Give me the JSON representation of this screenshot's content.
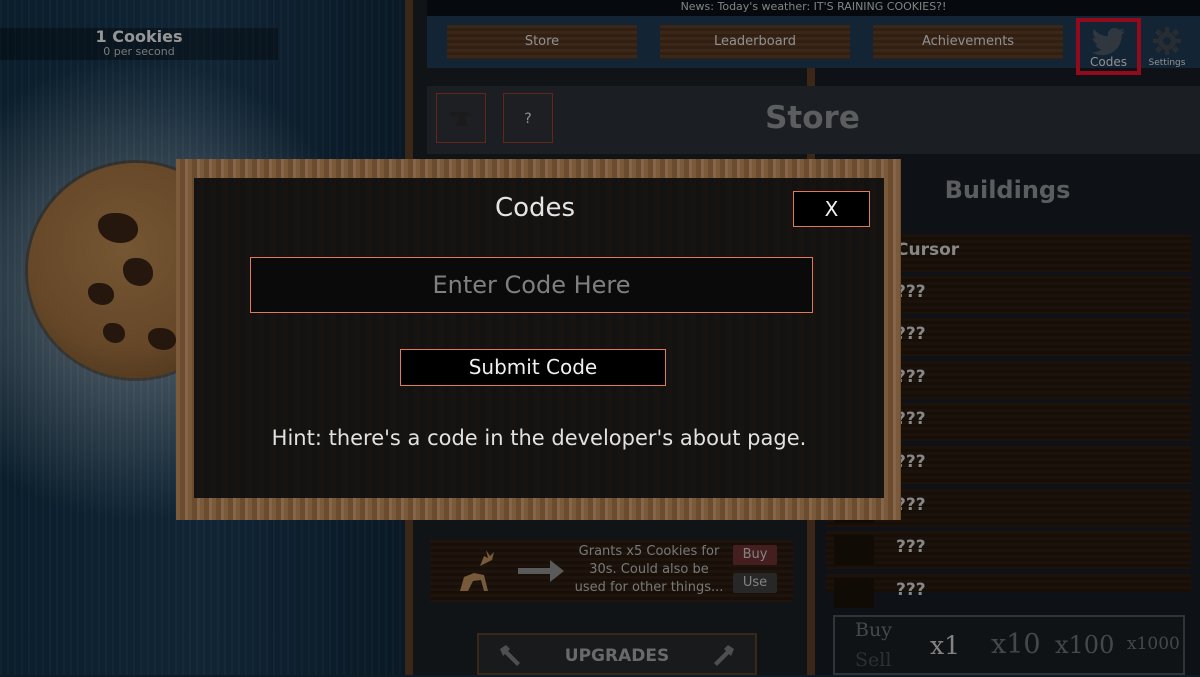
{
  "news": "News: Today's weather: IT'S RAINING COOKIES?!",
  "stats": {
    "cookies": "1 Cookies",
    "per_second": "0 per second"
  },
  "nav": {
    "store": "Store",
    "leaderboard": "Leaderboard",
    "achievements": "Achievements",
    "codes": "Codes",
    "settings": "Settings"
  },
  "store": {
    "title": "Store",
    "help_button": "?"
  },
  "buildings": {
    "title": "Buildings",
    "items": [
      {
        "name": "Cursor"
      },
      {
        "name": "???"
      },
      {
        "name": "???"
      },
      {
        "name": "???"
      },
      {
        "name": "???"
      },
      {
        "name": "???"
      },
      {
        "name": "???"
      },
      {
        "name": "???"
      },
      {
        "name": "???"
      }
    ]
  },
  "item": {
    "description": "Grants x5 Cookies for 30s. Could also be used for other things...",
    "buy": "Buy",
    "use": "Use"
  },
  "upgrades": "UPGRADES",
  "buy_sell": {
    "buy": "Buy",
    "sell": "Sell",
    "x1": "x1",
    "x10": "x10",
    "x100": "x100",
    "x1000": "x1000"
  },
  "modal": {
    "title": "Codes",
    "close": "X",
    "input_placeholder": "Enter Code Here",
    "submit": "Submit Code",
    "hint": "Hint: there's a code in the developer's about page."
  },
  "colors": {
    "accent_border": "#e07a5a",
    "highlight": "#e0102a",
    "wood": "#6b4c2f"
  }
}
